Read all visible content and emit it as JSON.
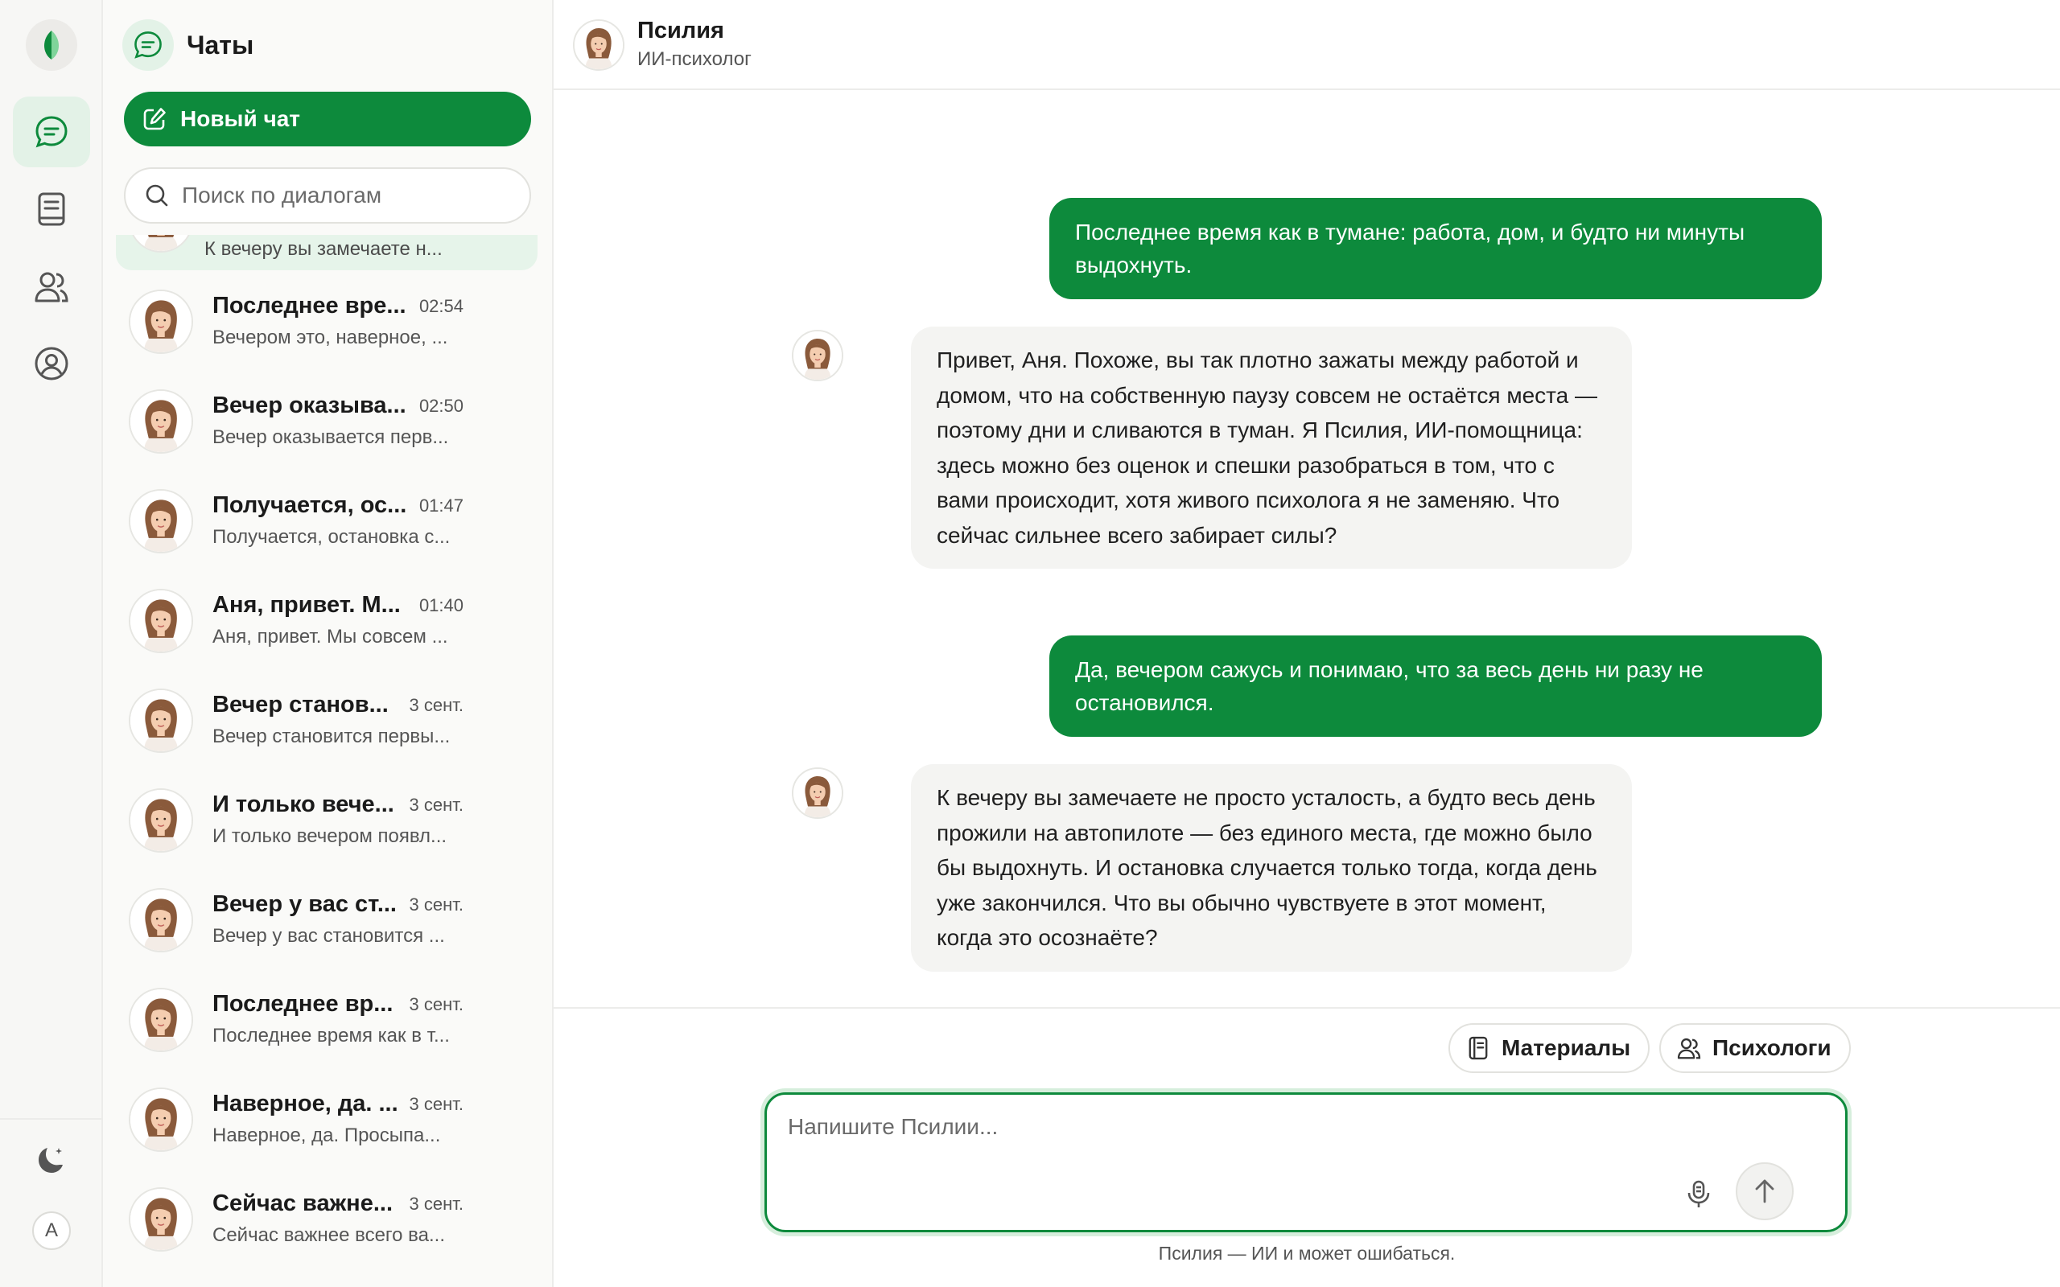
{
  "sidebar": {
    "title": "Чаты",
    "new_chat_label": "Новый чат",
    "search_placeholder": "Поиск по диалогам",
    "lang_label": "A",
    "active_chat_preview": "К вечеру вы замечаете н...",
    "chats": [
      {
        "title": "Последнее вре...",
        "time": "02:54",
        "preview": "Вечером это, наверное, ..."
      },
      {
        "title": "Вечер оказыва...",
        "time": "02:50",
        "preview": "Вечер оказывается перв..."
      },
      {
        "title": "Получается, ос...",
        "time": "01:47",
        "preview": "Получается, остановка с..."
      },
      {
        "title": "Аня, привет. М...",
        "time": "01:40",
        "preview": "Аня, привет. Мы совсем ..."
      },
      {
        "title": "Вечер станов...",
        "time": "3 сент.",
        "preview": "Вечер становится первы..."
      },
      {
        "title": "И только вече...",
        "time": "3 сент.",
        "preview": "И только вечером появл..."
      },
      {
        "title": "Вечер у вас ст...",
        "time": "3 сент.",
        "preview": "Вечер у вас становится ..."
      },
      {
        "title": "Последнее вр...",
        "time": "3 сент.",
        "preview": "Последнее время как в т..."
      },
      {
        "title": "Наверное, да. ...",
        "time": "3 сент.",
        "preview": "Наверное, да. Просыпа..."
      },
      {
        "title": "Сейчас важне...",
        "time": "3 сент.",
        "preview": "Сейчас важнее всего ва..."
      }
    ]
  },
  "header": {
    "name": "Псилия",
    "role": "ИИ-психолог"
  },
  "messages": [
    {
      "from": "user",
      "text": "Последнее время как в тумане: работа, дом, и будто ни минуты выдохнуть."
    },
    {
      "from": "bot",
      "text": "Привет, Аня. Похоже, вы так плотно зажаты между работой и домом, что на собственную паузу совсем не остаётся места — поэтому дни и сливаются в туман. Я Псилия, ИИ-помощница: здесь можно без оценок и спешки разобраться в том, что с вами происходит, хотя живого психолога я не заменяю. Что сейчас сильнее всего забирает силы?"
    },
    {
      "from": "user",
      "text": "Да, вечером сажусь и понимаю, что за весь день ни разу не остановился."
    },
    {
      "from": "bot",
      "text": "К вечеру вы замечаете не просто усталость, а будто весь день прожили на автопилоте — без единого места, где можно было бы выдохнуть. И остановка случается только тогда, когда день уже закончился. Что вы обычно чувствуете в этот момент, когда это осознаёте?"
    }
  ],
  "tools": {
    "materials_label": "Материалы",
    "psychologists_label": "Психологи"
  },
  "composer": {
    "placeholder": "Напишите Псилии..."
  },
  "disclaimer": "Псилия — ИИ и может ошибаться.",
  "colors": {
    "accent": "#0d8a3c",
    "accent_light": "#e3f2e7",
    "bot_bubble": "#f4f4f2"
  }
}
